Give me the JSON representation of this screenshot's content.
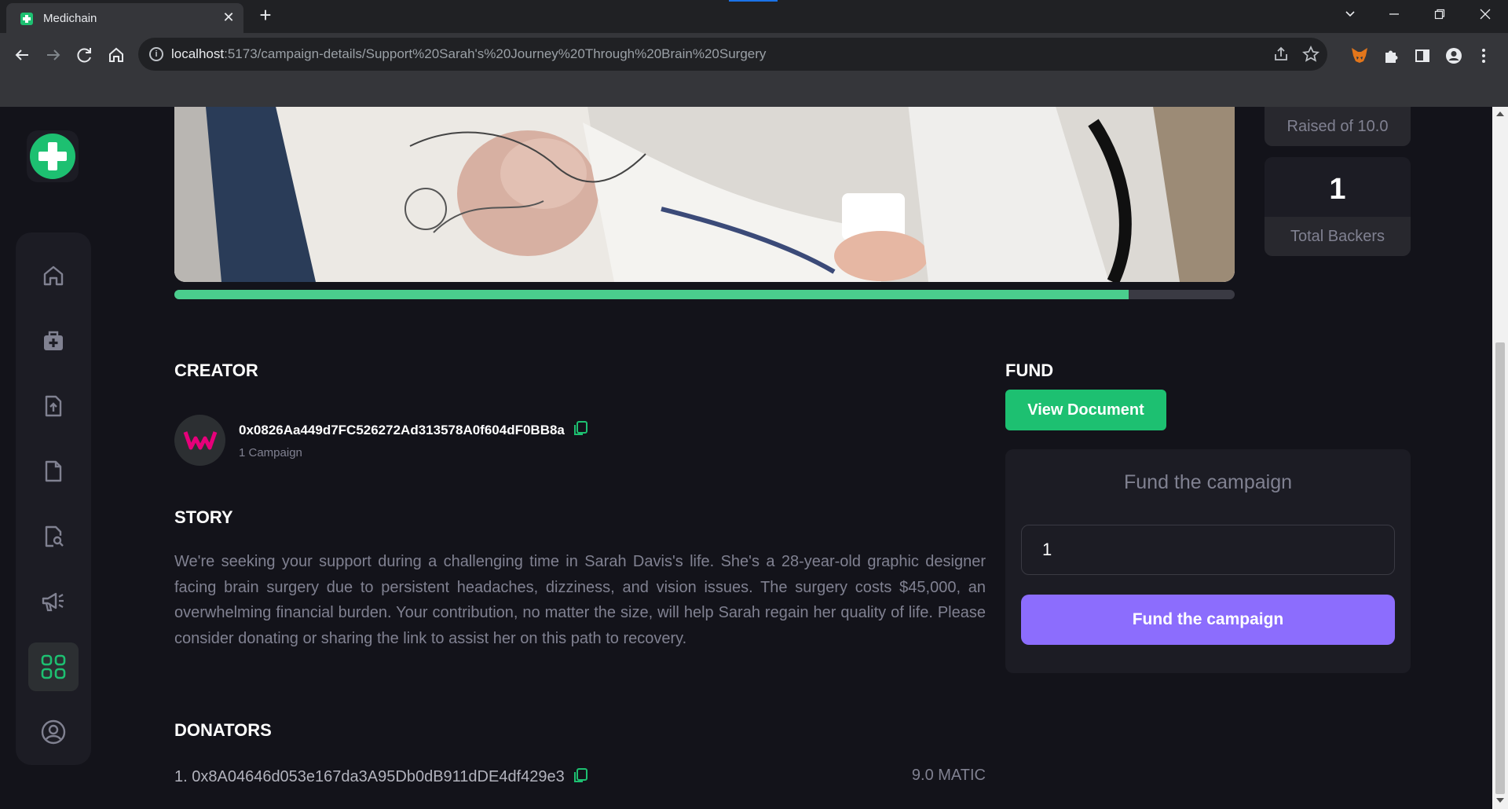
{
  "browser": {
    "tab_title": "Medichain",
    "url_host": "localhost",
    "url_path": ":5173/campaign-details/Support%20Sarah's%20Journey%20Through%20Brain%20Surgery"
  },
  "stats": {
    "raised_label": "Raised of 10.0",
    "backers_value": "1",
    "backers_label": "Total Backers"
  },
  "progress": {
    "fraction": 0.9
  },
  "creator": {
    "heading": "Creator",
    "address": "0x0826Aa449d7FC526272Ad313578A0f604dF0BB8a",
    "campaigns": "1 Campaign"
  },
  "story": {
    "heading": "Story",
    "text": "We're seeking your support during a challenging time in Sarah Davis's life. She's a 28-year-old graphic designer facing brain surgery due to persistent headaches, dizziness, and vision issues. The surgery costs $45,000, an overwhelming financial burden. Your contribution, no matter the size, will help Sarah regain her quality of life. Please consider donating or sharing the link to assist her on this path to recovery."
  },
  "donators": {
    "heading": "Donators",
    "items": [
      {
        "label": "1. 0x8A04646d053e167da3A95Db0dB911dDE4df429e3",
        "amount": "9.0 MATIC"
      }
    ]
  },
  "fund": {
    "heading": "Fund",
    "view_document": "View Document",
    "card_title": "Fund the campaign",
    "amount_value": "1",
    "submit_label": "Fund the campaign"
  },
  "colors": {
    "accent_green": "#1dc071",
    "progress_green": "#4acd8d",
    "accent_purple": "#8c6dfd",
    "background": "#13131a",
    "card": "#1c1c24"
  },
  "sidebar": {
    "icons": [
      "home-icon",
      "medical-kit-icon",
      "file-upload-icon",
      "document-icon",
      "document-search-icon",
      "megaphone-icon",
      "grid-icon",
      "profile-icon"
    ]
  }
}
